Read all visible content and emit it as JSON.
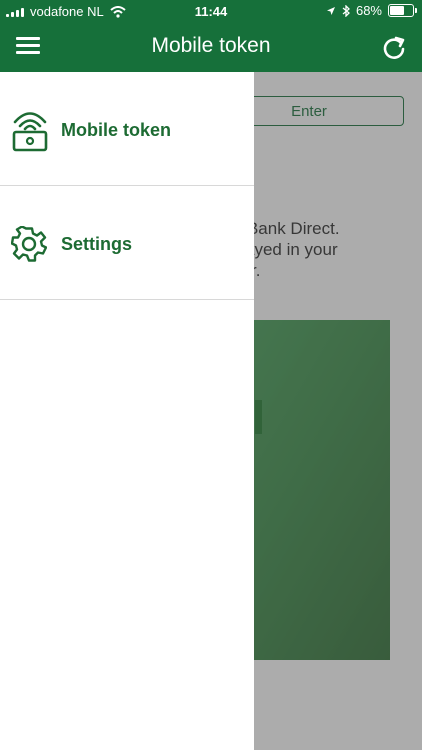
{
  "status_bar": {
    "carrier": "vodafone NL",
    "time": "11:44",
    "battery_percent": "68%",
    "battery_level": 0.68
  },
  "header": {
    "title": "Mobile token"
  },
  "drawer": {
    "items": [
      {
        "label": "Mobile token",
        "icon": "lock-wifi-icon"
      },
      {
        "label": "Settings",
        "icon": "gear-icon"
      }
    ]
  },
  "background_content": {
    "enter_label": "Enter",
    "instruction_line1": "ntiBank Direct.",
    "instruction_line2": "ayed in your",
    "instruction_line3": "r."
  },
  "colors": {
    "brand_green": "#16703a",
    "label_green": "#1d6b33"
  }
}
